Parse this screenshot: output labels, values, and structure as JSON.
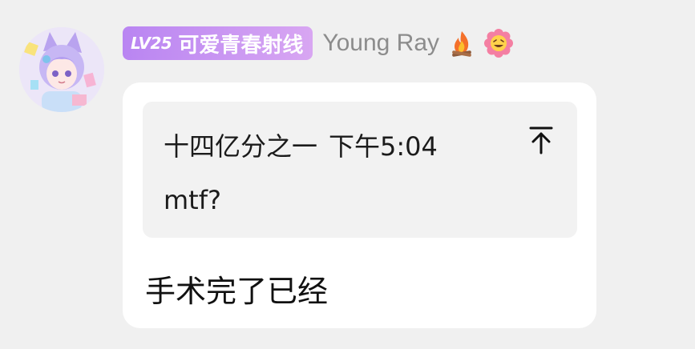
{
  "sender": {
    "level_badge": "LV25",
    "title_badge": "可爱青春射线",
    "name": "Young Ray",
    "emoji_icons": [
      "fire-icon",
      "flower-grin-icon"
    ],
    "badge_gradient": [
      "#b985f2",
      "#d8a6f2"
    ]
  },
  "quote": {
    "author": "十四亿分之一",
    "time": "下午5:04",
    "text": "mtf?",
    "pin_icon": "scroll-to-top-icon"
  },
  "message": {
    "text": "手术完了已经"
  }
}
